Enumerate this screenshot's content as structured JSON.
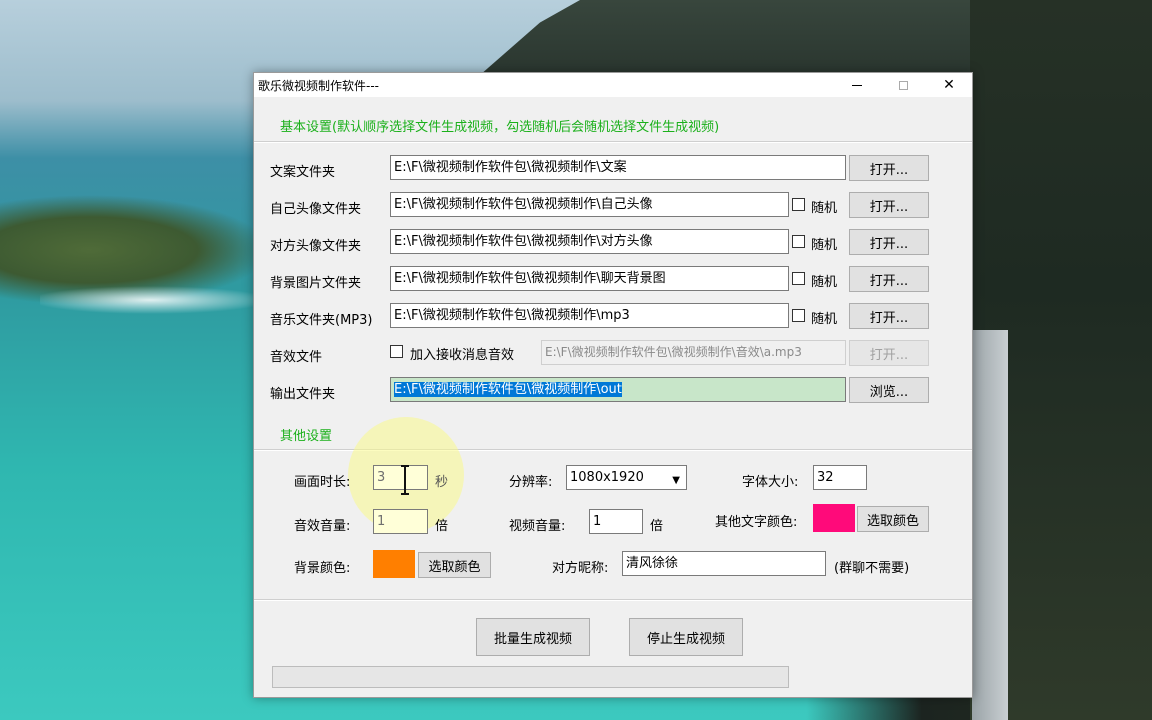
{
  "window": {
    "title": "歌乐微视频制作软件---",
    "close_glyph": "✕"
  },
  "basic": {
    "heading": "基本设置(默认顺序选择文件生成视频，勾选随机后会随机选择文件生成视频)",
    "rows": [
      {
        "label": "文案文件夹",
        "value": "E:\\F\\微视频制作软件包\\微视频制作\\文案",
        "button": "打开..."
      },
      {
        "label": "自己头像文件夹",
        "value": "E:\\F\\微视频制作软件包\\微视频制作\\自己头像",
        "random": "随机",
        "button": "打开..."
      },
      {
        "label": "对方头像文件夹",
        "value": "E:\\F\\微视频制作软件包\\微视频制作\\对方头像",
        "random": "随机",
        "button": "打开..."
      },
      {
        "label": "背景图片文件夹",
        "value": "E:\\F\\微视频制作软件包\\微视频制作\\聊天背景图",
        "random": "随机",
        "button": "打开..."
      },
      {
        "label": "音乐文件夹(MP3)",
        "value": "E:\\F\\微视频制作软件包\\微视频制作\\mp3",
        "random": "随机",
        "button": "打开..."
      }
    ],
    "sound": {
      "label": "音效文件",
      "checkbox_label": "加入接收消息音效",
      "value": "E:\\F\\微视频制作软件包\\微视频制作\\音效\\a.mp3",
      "button": "打开..."
    },
    "output": {
      "label": "输出文件夹",
      "value": "E:\\F\\微视频制作软件包\\微视频制作\\out",
      "button": "浏览..."
    }
  },
  "other": {
    "heading": "其他设置",
    "duration_label": "画面时长:",
    "duration_value": "3",
    "duration_unit": "秒",
    "resolution_label": "分辨率:",
    "resolution_value": "1080x1920",
    "font_size_label": "字体大小:",
    "font_size_value": "32",
    "sfx_volume_label": "音效音量:",
    "sfx_volume_value": "1",
    "sfx_volume_unit": "倍",
    "video_volume_label": "视频音量:",
    "video_volume_value": "1",
    "video_volume_unit": "倍",
    "text_color_label": "其他文字颜色:",
    "text_color": "#ff0a7a",
    "text_color_button": "选取颜色",
    "bg_color_label": "背景颜色:",
    "bg_color": "#ff7f00",
    "bg_color_button": "选取颜色",
    "nickname_label": "对方昵称:",
    "nickname_value": "清风徐徐",
    "nickname_note": "(群聊不需要)"
  },
  "actions": {
    "batch_button": "批量生成视频",
    "stop_button": "停止生成视频"
  },
  "progress": 0,
  "colors": {
    "section_heading": "#1bb01b",
    "selection": "#0078d7"
  }
}
